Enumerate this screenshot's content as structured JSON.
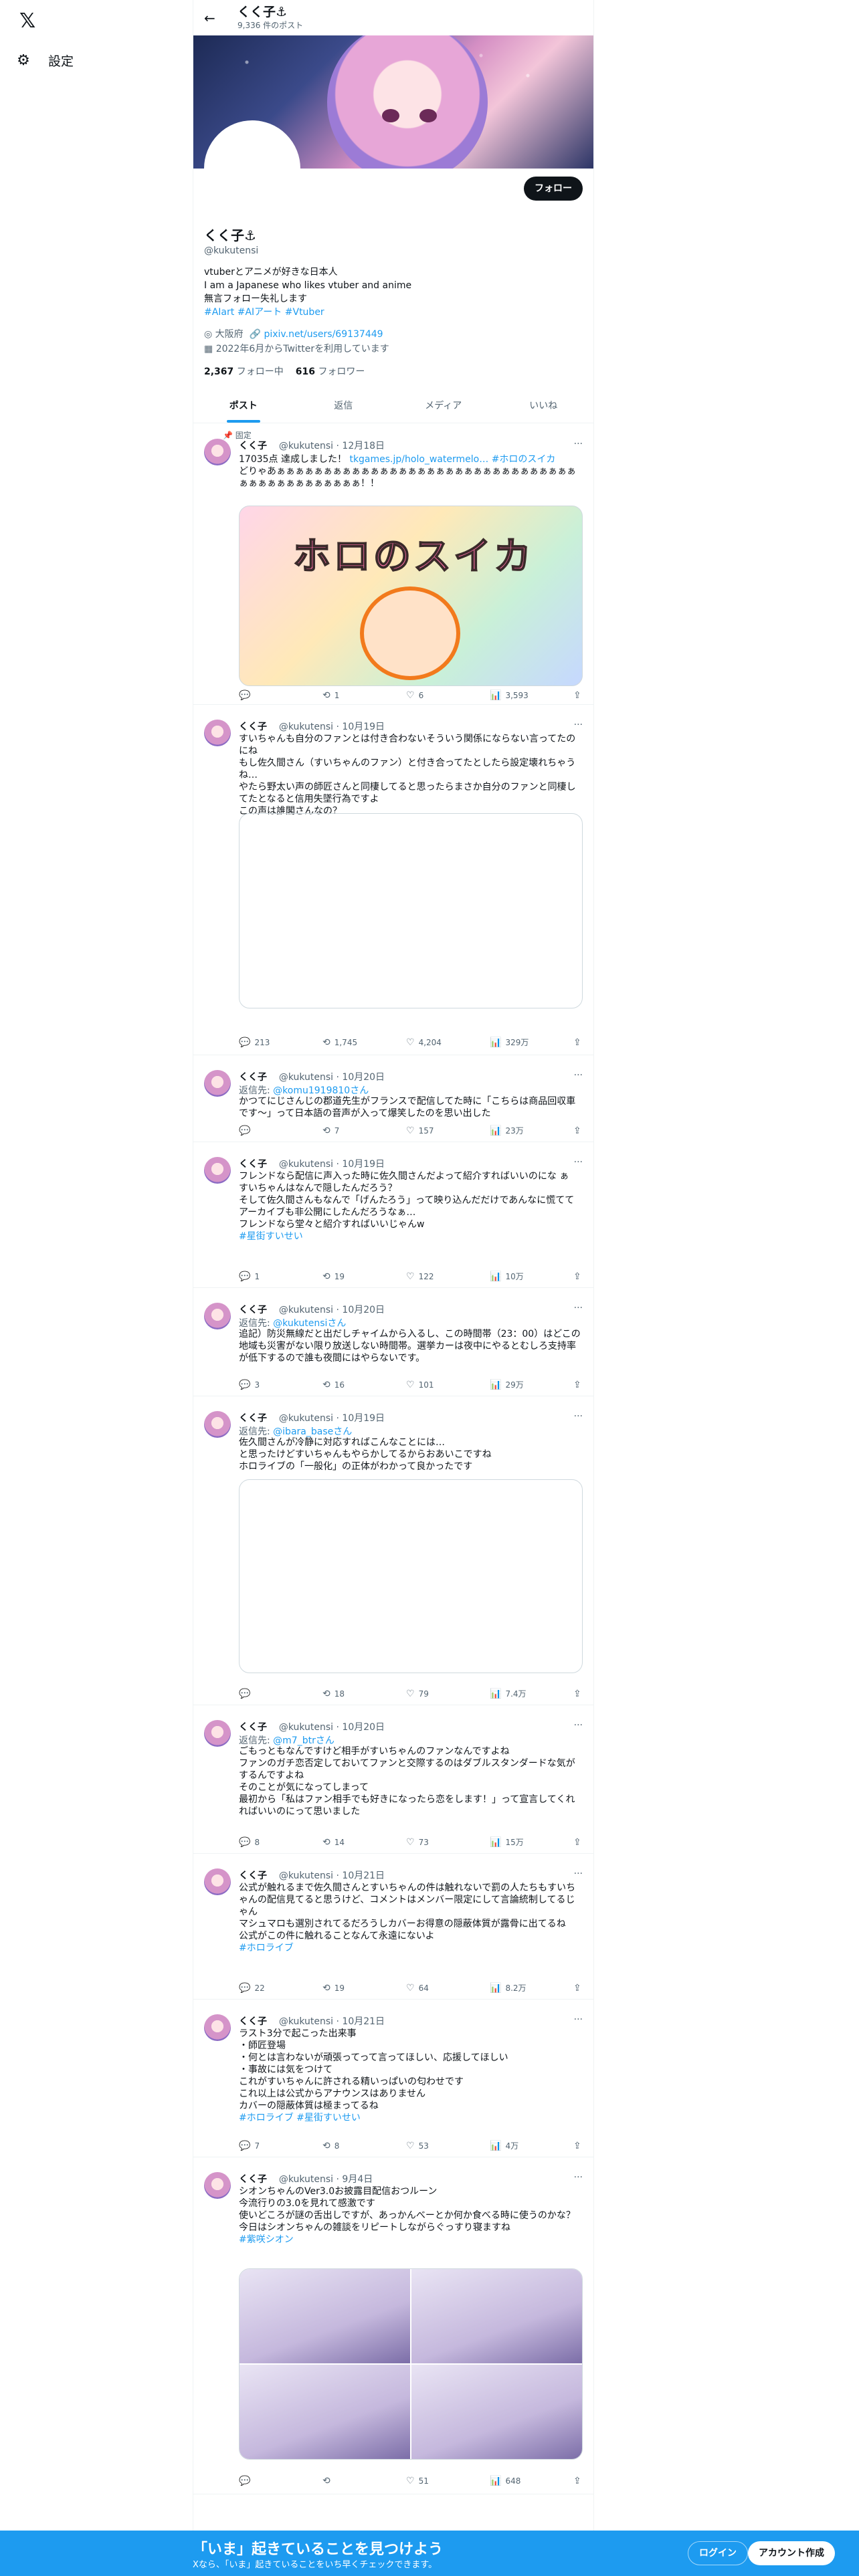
{
  "nav": {
    "logo": "𝕏",
    "settings_icon": "⚙",
    "settings_label": "設定"
  },
  "topbar": {
    "back": "←",
    "name": "くく子⚓",
    "count": "9,336 件のポスト"
  },
  "profile": {
    "name": "くく子⚓",
    "handle": "@kukutensi",
    "follow": "フォロー",
    "bio": "vtuberとアニメが好きな日本人\nI am a Japanese who likes vtuber and anime\n無言フォロー失礼します",
    "tags": "#AIart #AIアート #Vtuber",
    "location": "大阪府",
    "url": "pixiv.net/users/69137449",
    "joined": "2022年6月からTwitterを利用しています",
    "following_n": "2,367",
    "following_l": "フォロー中",
    "followers_n": "616",
    "followers_l": "フォロワー"
  },
  "tabs": [
    "ポスト",
    "返信",
    "メディア",
    "いいね"
  ],
  "tweets": [
    {
      "pin": "📌 固定",
      "name": "くく子",
      "handle": "@kukutensi · 12月18日",
      "body": "17035点 達成しました！",
      "link": "tkgames.jp/holo_watermelo… #ホロのスイカ",
      "body2": "どりゃあぁぁぁぁぁぁぁぁぁぁぁぁぁぁぁぁぁぁぁぁぁぁぁぁぁぁぁぁぁぁぁぁぁぁぁぁぁぁぁぁぁぁぁぁぁ！！",
      "media_text": "ホロのスイカ",
      "reply": "",
      "rt": "1",
      "like": "6",
      "views": "3,593"
    },
    {
      "name": "くく子",
      "handle": "@kukutensi · 10月19日",
      "body": "すいちゃんも自分のファンとは付き合わないそういう関係にならない言ってたのにね\nもし佐久間さん（すいちゃんのファン）と付き合ってたとしたら設定壊れちゃうね…\nやたら野太い声の師匠さんと同棲してると思ったらまさか自分のファンと同棲してたとなると信用失墜行為ですよ\nこの声は誰閣さんなの？",
      "reply": "213",
      "rt": "1,745",
      "like": "4,204",
      "views": "329万"
    },
    {
      "name": "くく子",
      "handle": "@kukutensi · 10月20日",
      "replyto": "返信先: ",
      "replyh": "@komu1919810さん",
      "body": "かつてにじさんじの郡道先生がフランスで配信してた時に「こちらは商品回収車です〜」って日本語の音声が入って爆笑したのを思い出した",
      "reply": "",
      "rt": "7",
      "like": "157",
      "views": "23万"
    },
    {
      "name": "くく子",
      "handle": "@kukutensi · 10月19日",
      "body": "フレンドなら配信に声入った時に佐久間さんだよって紹介すればいいのにな ぁ\nすいちゃんはなんで隠したんだろう？\nそして佐久間さんもなんで「げんたろう」って映り込んだだけであんなに慌ててアーカイブも非公開にしたんだろうなぁ…\nフレンドなら堂々と紹介すればいいじゃんw",
      "tags": "#星街すいせい",
      "reply": "1",
      "rt": "19",
      "like": "122",
      "views": "10万"
    },
    {
      "name": "くく子",
      "handle": "@kukutensi · 10月20日",
      "replyto": "返信先: ",
      "replyh": "@kukutensiさん",
      "body": "追記）防災無線だと出だしチャイムから入るし、この時間帯（23：00）はどこの地域も災害がない限り放送しない時間帯。選挙カーは夜中にやるとむしろ支持率が低下するので誰も夜間にはやらないです。",
      "reply": "3",
      "rt": "16",
      "like": "101",
      "views": "29万"
    },
    {
      "name": "くく子",
      "handle": "@kukutensi · 10月19日",
      "replyto": "返信先: ",
      "replyh": "@ibara_baseさん",
      "body": "佐久間さんが冷静に対応すればこんなことには…\nと思ったけどすいちゃんもやらかしてるからおあいこですね\nホロライブの「一般化」の正体がわかって良かったです",
      "reply": "",
      "rt": "18",
      "like": "79",
      "views": "7.4万"
    },
    {
      "name": "くく子",
      "handle": "@kukutensi · 10月20日",
      "replyto": "返信先: ",
      "replyh": "@m7_btrさん",
      "body": "ごもっともなんですけど相手がすいちゃんのファンなんですよね\nファンのガチ恋否定しておいてファンと交際するのはダブルスタンダードな気がするんですよね\nそのことが気になってしまって\n最初から「私はファン相手でも好きになったら恋をします！」って宣言してくれればいいのにって思いました",
      "reply": "8",
      "rt": "14",
      "like": "73",
      "views": "15万"
    },
    {
      "name": "くく子",
      "handle": "@kukutensi · 10月21日",
      "body": "公式が触れるまで佐久間さんとすいちゃんの件は触れないで罰の人たちもすいちゃんの配信見てると思うけど、コメントはメンバー限定にして言論統制してるじゃん\nマシュマロも選別されてるだろうしカバーお得意の隠蔽体質が露骨に出てるね\n公式がこの件に触れることなんて永遠にないよ",
      "tags": "#ホロライブ",
      "reply": "22",
      "rt": "19",
      "like": "64",
      "views": "8.2万"
    },
    {
      "name": "くく子",
      "handle": "@kukutensi · 10月21日",
      "body": "ラスト3分で起こった出来事\n・師匠登場\n・何とは言わないが頑張ってって言ってほしい、応援してほしい\n・事故には気をつけて\nこれがすいちゃんに許される精いっぱいの匂わせです\nこれ以上は公式からアナウンスはありません\nカバーの隠蔽体質は極まってるね",
      "tags": "#ホロライブ  #星街すいせい",
      "reply": "7",
      "rt": "8",
      "like": "53",
      "views": "4万"
    },
    {
      "name": "くく子",
      "handle": "@kukutensi · 9月4日",
      "body": "シオンちゃんのVer3.0お披露目配信おつルーン\n今流行りの3.0を見れて感激です\n使いどころが謎の舌出しですが、あっかんべーとか何か食べる時に使うのかな？\n今日はシオンちゃんの雑談をリピートしながらぐっすり寝ますね",
      "tags": "#紫咲シオン",
      "reply": "",
      "rt": "",
      "like": "51",
      "views": "648"
    }
  ],
  "icons": {
    "more": "···",
    "reply": "💬",
    "retweet": "⟲",
    "like": "♡",
    "views": "📊",
    "share": "⇪",
    "location": "◎",
    "link": "🔗",
    "calendar": "▦"
  },
  "bottom": {
    "title": "「いま」起きていることを見つけよう",
    "sub": "Xなら、「いま」起きていることをいち早くチェックできます。",
    "login": "ログイン",
    "signup": "アカウント作成"
  }
}
